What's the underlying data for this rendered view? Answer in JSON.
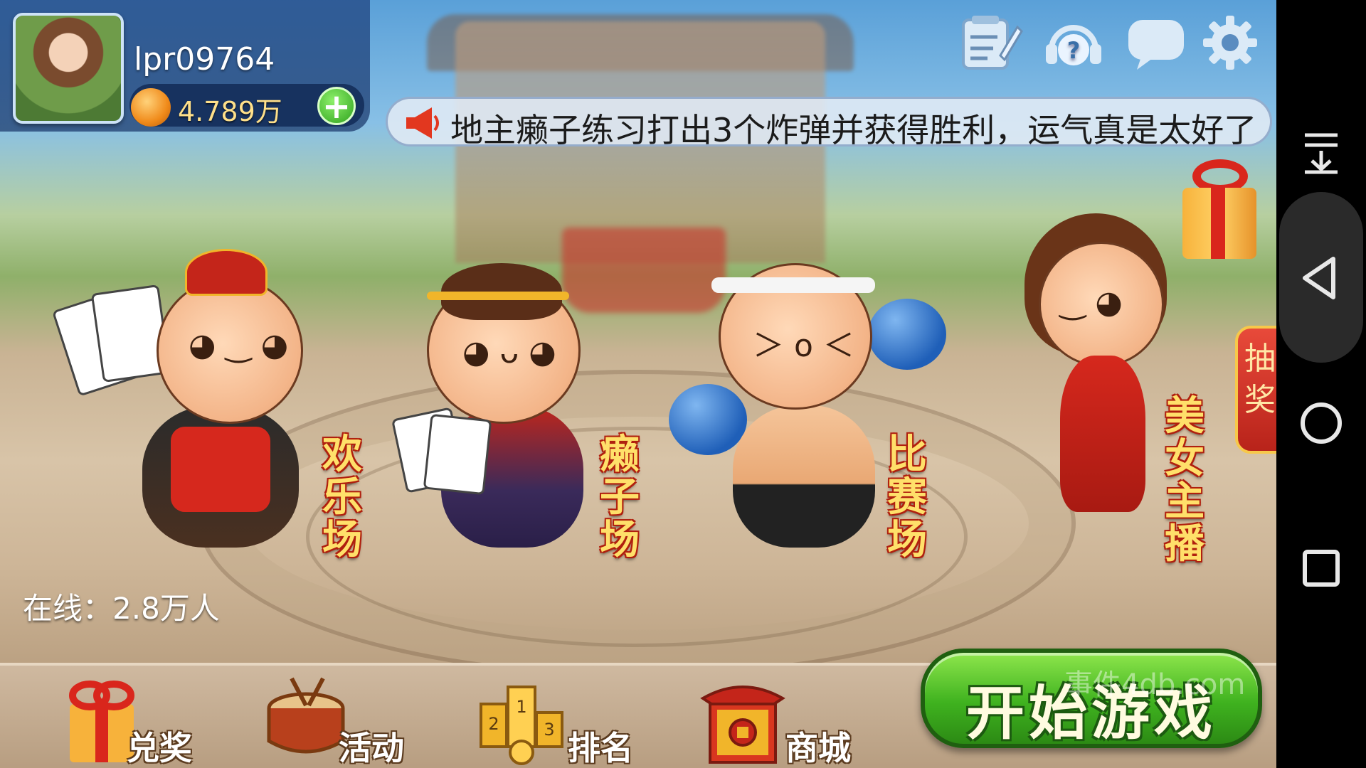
{
  "user": {
    "username": "lpr09764",
    "coins": "4.789万"
  },
  "top_icons": [
    "notepad-icon",
    "help-headset-icon",
    "chat-bubble-icon",
    "gear-icon"
  ],
  "marquee": {
    "text": "地主癞子练习打出3个炸弹并获得胜利，运气真是太好了"
  },
  "lottery": {
    "label": "抽奖"
  },
  "modes": [
    {
      "label": "欢乐场"
    },
    {
      "label": "癞子场"
    },
    {
      "label": "比赛场"
    },
    {
      "label": "美女主播"
    }
  ],
  "online": {
    "text": "在线：2.8万人"
  },
  "bottom_nav": [
    {
      "label": "兑奖",
      "icon": "gift-box-icon"
    },
    {
      "label": "活动",
      "icon": "drum-icon"
    },
    {
      "label": "排名",
      "icon": "podium-icon"
    },
    {
      "label": "商城",
      "icon": "shop-pavilion-icon"
    }
  ],
  "start_button": {
    "label": "开始游戏"
  },
  "watermark": "事件4db.com",
  "colors": {
    "gold": "#ffe06a",
    "green": "#3fb21f",
    "red": "#d9261c"
  }
}
